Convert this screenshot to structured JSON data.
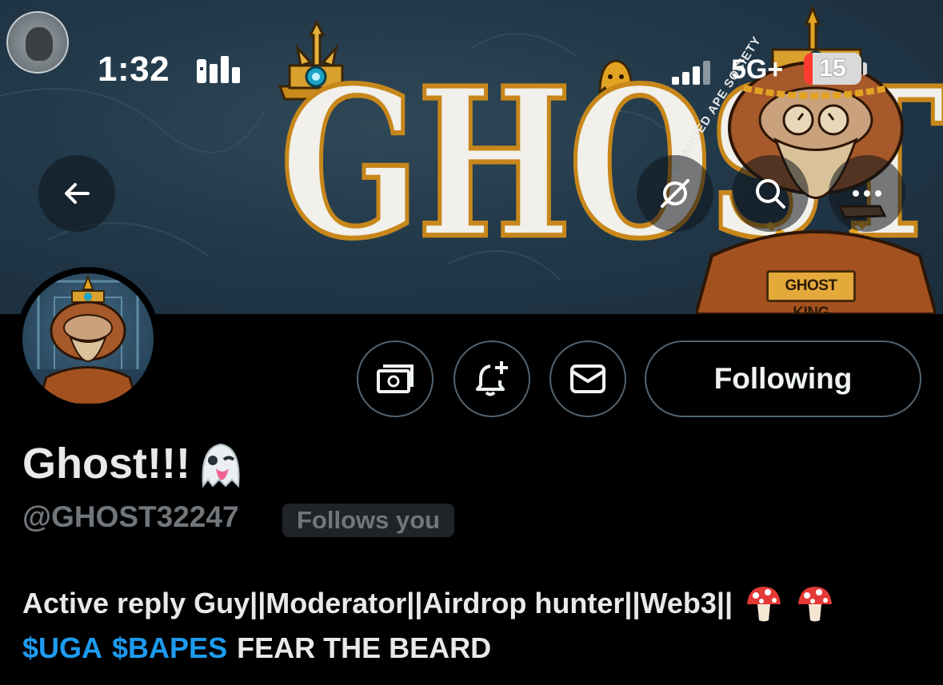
{
  "status_bar": {
    "time": "1:32",
    "network": "5G+",
    "battery": "15",
    "battery_level_percent": 15
  },
  "banner": {
    "logo_text": "GHOST",
    "watermark": "BEARDED APE SOCIETY",
    "tag": "GHOST KING",
    "badge_text": "BEARDED APE SOCIETY"
  },
  "nav": {
    "back_icon": "arrow-left-icon",
    "grok_icon": "grok-icon",
    "search_icon": "search-icon",
    "more_icon": "more-horizontal-icon"
  },
  "actions": {
    "tip_icon": "money-icon",
    "notify_icon": "bell-plus-icon",
    "message_icon": "envelope-icon",
    "following_label": "Following"
  },
  "profile": {
    "display_name": "Ghost!!!",
    "display_name_emoji": "ghost-emoji",
    "handle": "@GHOST32247",
    "follows_you": "Follows you",
    "bio_line1": "Active reply Guy||Moderator||Airdrop hunter||Web3||",
    "bio_line1_emoji": [
      "mushroom-emoji",
      "mushroom-emoji"
    ],
    "bio_cashtag1": "$UGA",
    "bio_cashtag2": "$BAPES",
    "bio_rest": "FEAR THE BEARD"
  },
  "colors": {
    "background": "#000000",
    "accent": "#1d9bf0",
    "secondary_text": "#71767b",
    "border": "#536471",
    "logo_outline": "#c8871b"
  }
}
